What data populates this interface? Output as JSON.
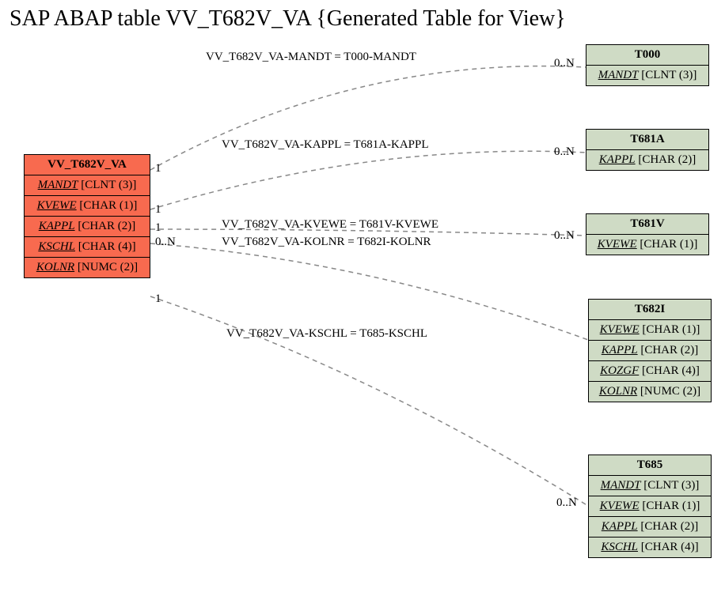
{
  "title": "SAP ABAP table VV_T682V_VA {Generated Table for View}",
  "main": {
    "name": "VV_T682V_VA",
    "fields": [
      {
        "name": "MANDT",
        "type": "[CLNT (3)]"
      },
      {
        "name": "KVEWE",
        "type": "[CHAR (1)]"
      },
      {
        "name": "KAPPL",
        "type": "[CHAR (2)]"
      },
      {
        "name": "KSCHL",
        "type": "[CHAR (4)]"
      },
      {
        "name": "KOLNR",
        "type": "[NUMC (2)]"
      }
    ]
  },
  "related": [
    {
      "name": "T000",
      "fields": [
        {
          "name": "MANDT",
          "type": "[CLNT (3)]"
        }
      ]
    },
    {
      "name": "T681A",
      "fields": [
        {
          "name": "KAPPL",
          "type": "[CHAR (2)]"
        }
      ]
    },
    {
      "name": "T681V",
      "fields": [
        {
          "name": "KVEWE",
          "type": "[CHAR (1)]"
        }
      ]
    },
    {
      "name": "T682I",
      "fields": [
        {
          "name": "KVEWE",
          "type": "[CHAR (1)]"
        },
        {
          "name": "KAPPL",
          "type": "[CHAR (2)]"
        },
        {
          "name": "KOZGF",
          "type": "[CHAR (4)]"
        },
        {
          "name": "KOLNR",
          "type": "[NUMC (2)]"
        }
      ]
    },
    {
      "name": "T685",
      "fields": [
        {
          "name": "MANDT",
          "type": "[CLNT (3)]"
        },
        {
          "name": "KVEWE",
          "type": "[CHAR (1)]"
        },
        {
          "name": "KAPPL",
          "type": "[CHAR (2)]"
        },
        {
          "name": "KSCHL",
          "type": "[CHAR (4)]"
        }
      ]
    }
  ],
  "edges": [
    {
      "label": "VV_T682V_VA-MANDT = T000-MANDT",
      "left_card": "1",
      "right_card": "0..N"
    },
    {
      "label": "VV_T682V_VA-KAPPL = T681A-KAPPL",
      "left_card": "1",
      "right_card": "0..N"
    },
    {
      "label": "VV_T682V_VA-KVEWE = T681V-KVEWE",
      "left_card": "1",
      "right_card": "0..N"
    },
    {
      "label": "VV_T682V_VA-KOLNR = T682I-KOLNR",
      "left_card": "0..N",
      "right_card": ""
    },
    {
      "label": "VV_T682V_VA-KSCHL = T685-KSCHL",
      "left_card": "1",
      "right_card": "0..N"
    }
  ]
}
